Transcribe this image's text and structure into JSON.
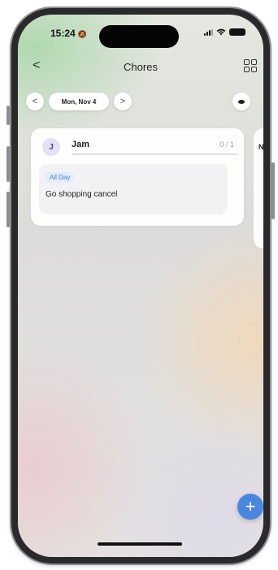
{
  "status_bar": {
    "time": "15:24",
    "bell_icon": "bell-slash-icon",
    "signal_icon": "cellular-signal-icon",
    "wifi_icon": "wifi-icon",
    "battery_icon": "battery-icon"
  },
  "nav": {
    "back_icon": "chevron-left-icon",
    "back_label": "<",
    "title": "Chores",
    "grid_icon": "grid-icon"
  },
  "date_nav": {
    "prev_label": "<",
    "date": "Mon, Nov 4",
    "next_label": ">",
    "eye_icon": "eye-icon"
  },
  "member_card": {
    "avatar_initial": "J",
    "name": "Jam",
    "progress_text": "0 / 1",
    "progress_fraction": 0,
    "chores": [
      {
        "tag": "All Day",
        "title": "Go shopping cancel"
      }
    ]
  },
  "next_card": {
    "peek_text": "N"
  },
  "fab": {
    "label": "+",
    "icon": "plus-icon"
  },
  "colors": {
    "accent": "#4a86de",
    "tag_text": "#4a7fd6",
    "tag_bg": "#e4ecfa",
    "avatar_bg": "#e3e1f3"
  }
}
